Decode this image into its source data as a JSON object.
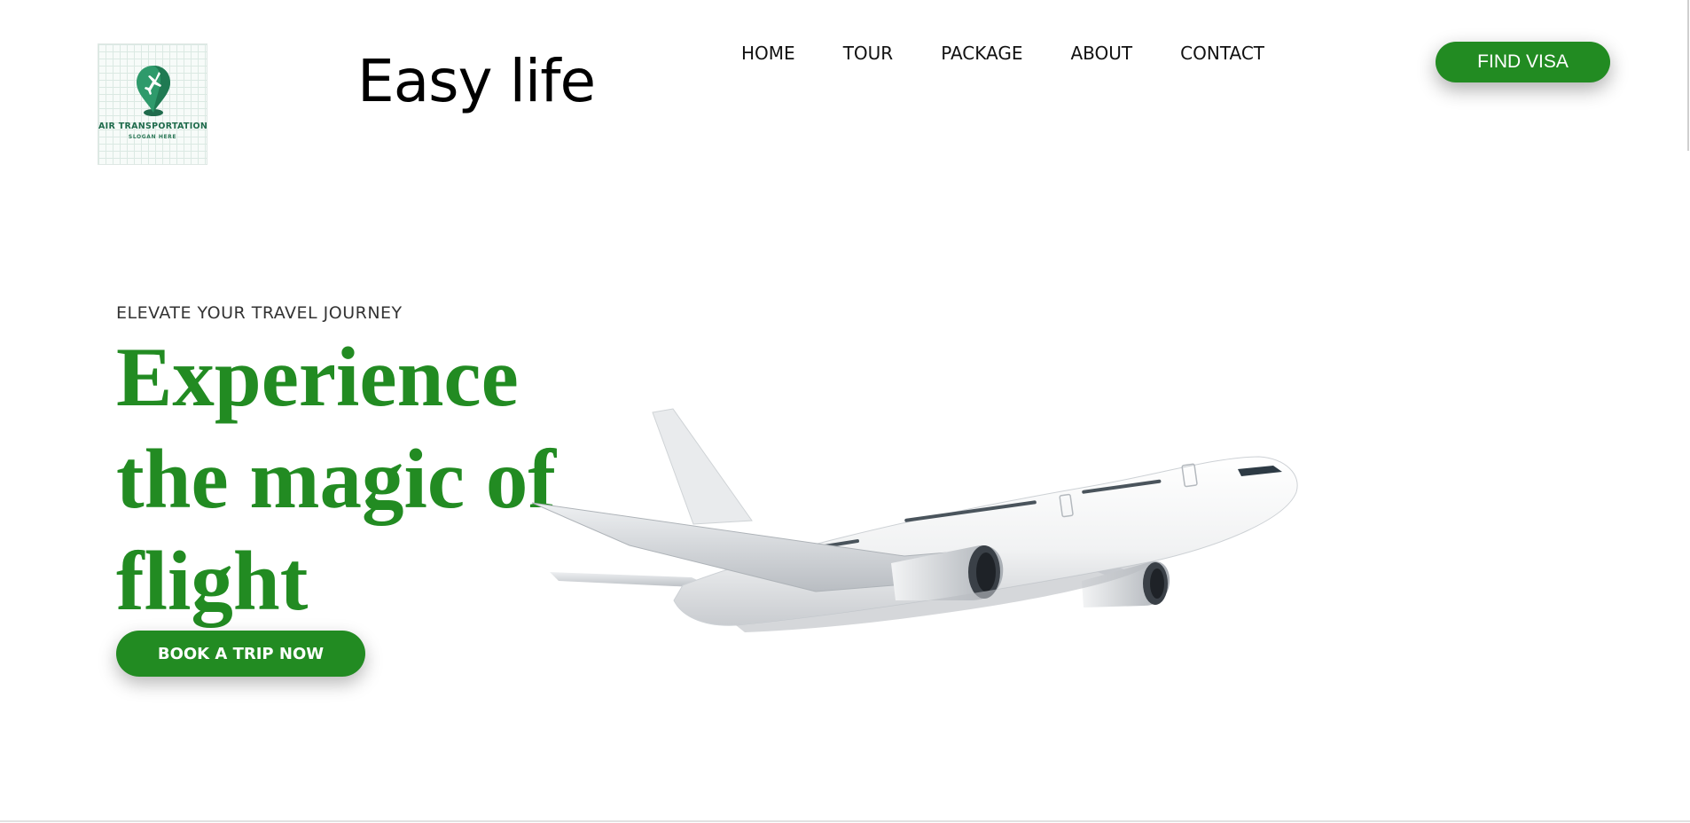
{
  "logo": {
    "title": "AIR TRANSPORTATION",
    "slogan": "SLOGAN HERE",
    "icon": "plane-pin-icon"
  },
  "brand": {
    "name": "Easy life"
  },
  "nav": {
    "items": [
      {
        "label": "HOME"
      },
      {
        "label": "TOUR"
      },
      {
        "label": "PACKAGE"
      },
      {
        "label": "ABOUT"
      },
      {
        "label": "CONTACT"
      }
    ]
  },
  "header": {
    "cta_label": "FIND VISA"
  },
  "hero": {
    "tagline": "ELEVATE YOUR TRAVEL JOURNEY",
    "headline": "Experience the magic of flight",
    "cta_label": "BOOK A TRIP NOW",
    "image": "airplane-photo"
  },
  "colors": {
    "accent": "#228b22",
    "text": "#111111",
    "tagline": "#333333",
    "background": "#ffffff"
  }
}
